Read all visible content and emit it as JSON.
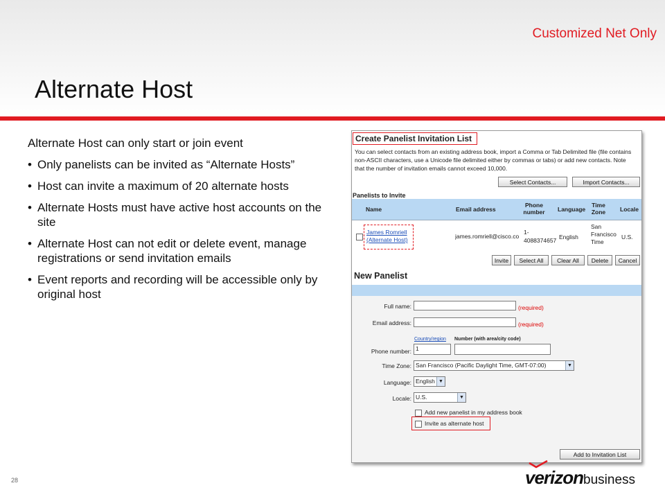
{
  "slide": {
    "subtitle": "Customized Net Only",
    "title": "Alternate Host",
    "lead": "Alternate Host can only start or join event",
    "bullets": [
      "Only panelists can be invited as “Alternate Hosts”",
      "Host can invite a maximum of 20 alternate hosts",
      "Alternate Hosts must have active host accounts on the site",
      "Alternate Host can not edit or delete event, manage registrations or send invitation emails",
      "Event reports and recording will be accessible only by original host"
    ],
    "bullet_glyph": "•",
    "page_number": "28",
    "logo_main": "verizon",
    "logo_sub": "business",
    "accent_color": "#e11b22"
  },
  "screenshot": {
    "title": "Create Panelist Invitation List",
    "description": "You can select contacts from an existing address book, import a Comma or Tab Delimited file (file contains non-ASCII characters, use a Unicode file delimited either by commas or tabs) or add new contacts. Note that the number of invitation emails cannot exceed 10,000.",
    "select_contacts": "Select Contacts...",
    "import_contacts": "Import Contacts...",
    "panelists_label": "Panelists to Invite",
    "columns": {
      "name": "Name",
      "email": "Email address",
      "phone": "Phone number",
      "language": "Language",
      "timezone": "Time Zone",
      "locale": "Locale"
    },
    "row": {
      "name": "James Romriell",
      "role": "(Alternate Host)",
      "email": "james.romriell@cisco.co",
      "phone_1": "1-",
      "phone_2": "4088374657",
      "language": "English",
      "timezone": "San Francisco Time",
      "locale": "U.S."
    },
    "actions": [
      "Invite",
      "Select All",
      "Clear All",
      "Delete",
      "Cancel"
    ],
    "new_panelist": {
      "heading": "New Panelist",
      "full_name_label": "Full name:",
      "full_name_value": "",
      "email_label": "Email address:",
      "email_value": "",
      "required": "(required)",
      "country_region": "Country/region",
      "number_hint": "Number (with area/city code)",
      "phone_label": "Phone number:",
      "country_code": "1",
      "phone_value": "",
      "timezone_label": "Time Zone:",
      "timezone_value": "San Francisco (Pacific Daylight Time, GMT-07:00)",
      "language_label": "Language:",
      "language_value": "English",
      "locale_label": "Locale:",
      "locale_value": "U.S.",
      "add_to_address_book": "Add new panelist in my address book",
      "invite_alternate": "Invite as alternate host",
      "add_button": "Add to Invitation List"
    }
  }
}
